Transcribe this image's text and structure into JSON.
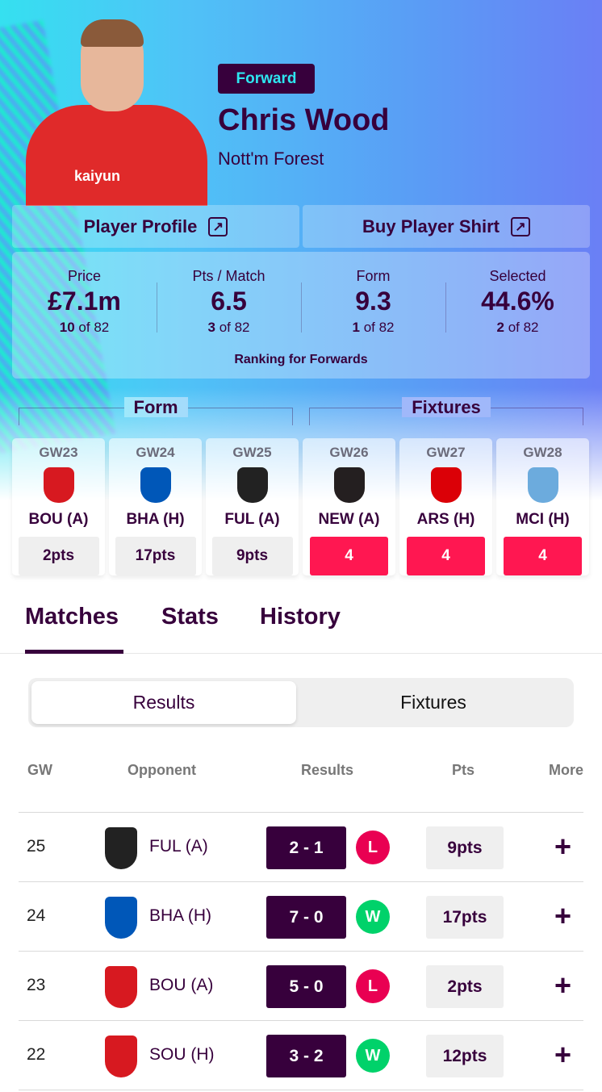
{
  "player": {
    "position": "Forward",
    "name": "Chris Wood",
    "team": "Nott'm Forest",
    "shirt_sponsor": "kaiyun"
  },
  "links": {
    "profile": "Player Profile",
    "shirt": "Buy Player Shirt",
    "icon": "external-link-icon"
  },
  "stats": [
    {
      "label": "Price",
      "value": "£7.1m",
      "rank": "10",
      "of": "of 82"
    },
    {
      "label": "Pts / Match",
      "value": "6.5",
      "rank": "3",
      "of": "of 82"
    },
    {
      "label": "Form",
      "value": "9.3",
      "rank": "1",
      "of": "of 82"
    },
    {
      "label": "Selected",
      "value": "44.6%",
      "rank": "2",
      "of": "of 82"
    }
  ],
  "ranking_note": "Ranking for Forwards",
  "sections": {
    "form": "Form",
    "fixtures": "Fixtures"
  },
  "gameweeks": [
    {
      "gw": "GW23",
      "opponent": "BOU (A)",
      "value": "2pts",
      "type": "form",
      "crest_color": "#d71920"
    },
    {
      "gw": "GW24",
      "opponent": "BHA (H)",
      "value": "17pts",
      "type": "form",
      "crest_color": "#0057b8"
    },
    {
      "gw": "GW25",
      "opponent": "FUL (A)",
      "value": "9pts",
      "type": "form",
      "crest_color": "#222222"
    },
    {
      "gw": "GW26",
      "opponent": "NEW (A)",
      "value": "4",
      "type": "fixture",
      "crest_color": "#241f20"
    },
    {
      "gw": "GW27",
      "opponent": "ARS (H)",
      "value": "4",
      "type": "fixture",
      "crest_color": "#db0007"
    },
    {
      "gw": "GW28",
      "opponent": "MCI (H)",
      "value": "4",
      "type": "fixture",
      "crest_color": "#6cabdd"
    }
  ],
  "tabs": [
    "Matches",
    "Stats",
    "History"
  ],
  "active_tab": "Matches",
  "segments": {
    "results": "Results",
    "fixtures": "Fixtures",
    "active": "Results"
  },
  "table": {
    "headers": {
      "gw": "GW",
      "opponent": "Opponent",
      "results": "Results",
      "pts": "Pts",
      "more": "More"
    },
    "rows": [
      {
        "gw": "25",
        "opponent": "FUL (A)",
        "score": "2 - 1",
        "result": "L",
        "pts": "9pts",
        "crest_color": "#222222"
      },
      {
        "gw": "24",
        "opponent": "BHA (H)",
        "score": "7 - 0",
        "result": "W",
        "pts": "17pts",
        "crest_color": "#0057b8"
      },
      {
        "gw": "23",
        "opponent": "BOU (A)",
        "score": "5 - 0",
        "result": "L",
        "pts": "2pts",
        "crest_color": "#d71920"
      },
      {
        "gw": "22",
        "opponent": "SOU (H)",
        "score": "3 - 2",
        "result": "W",
        "pts": "12pts",
        "crest_color": "#d71920"
      }
    ],
    "more_icon": "+"
  },
  "colors": {
    "primary": "#37003c",
    "fdr_hard": "#ff1751",
    "win": "#00d26a",
    "loss": "#e90052",
    "position_text": "#2ee6f0"
  }
}
